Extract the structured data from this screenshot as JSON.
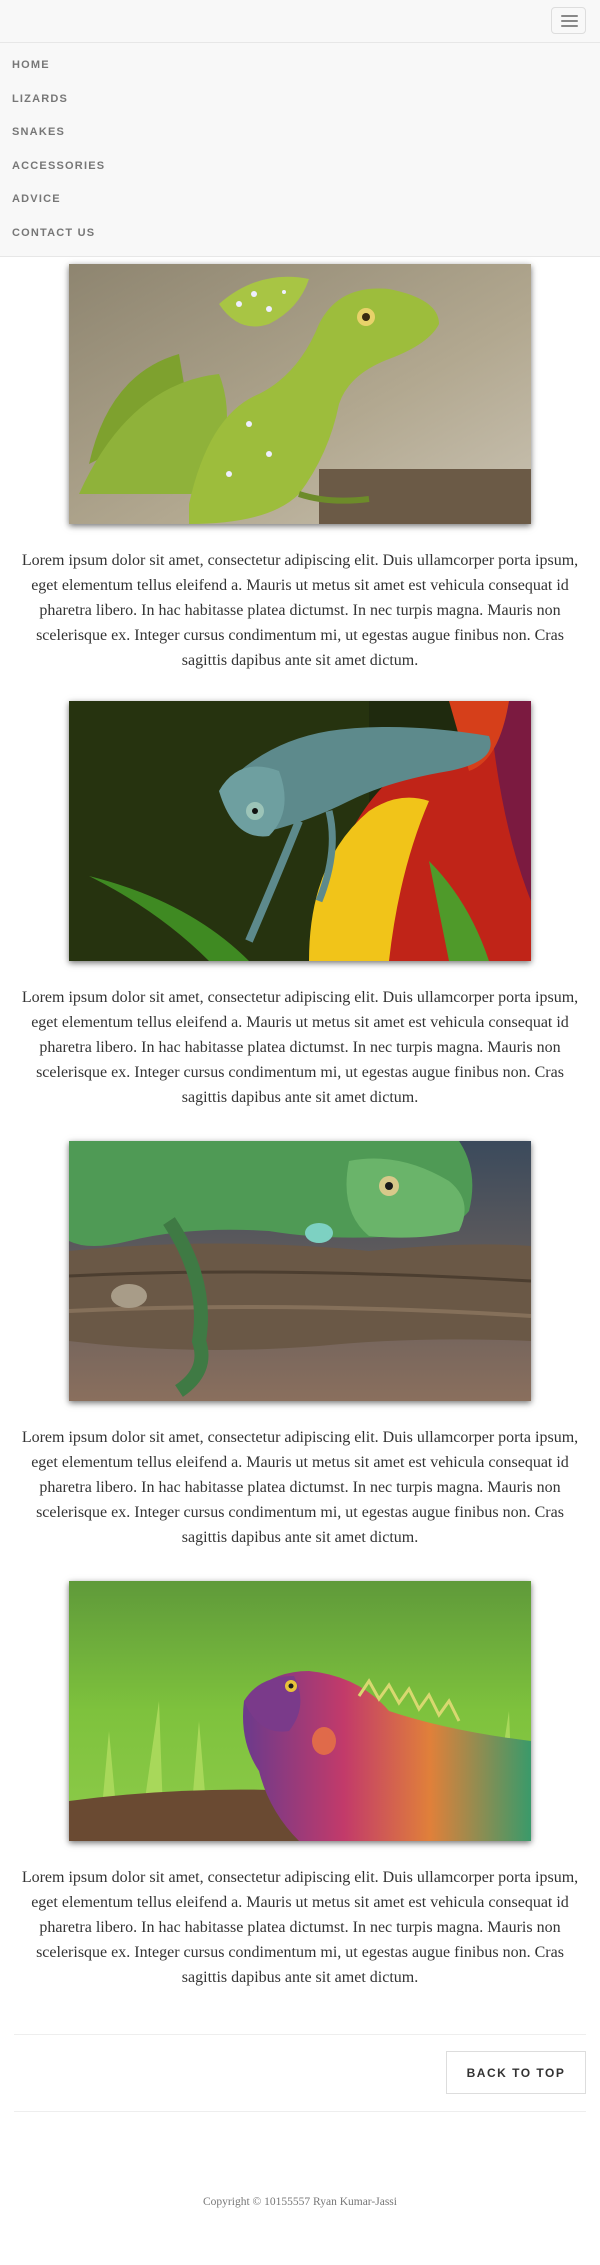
{
  "nav": {
    "toggle_icon": "hamburger-icon",
    "items": [
      {
        "label": "HOME"
      },
      {
        "label": "LIZARDS"
      },
      {
        "label": "SNAKES"
      },
      {
        "label": "ACCESSORIES"
      },
      {
        "label": "ADVICE"
      },
      {
        "label": "CONTACT US"
      }
    ]
  },
  "posts": [
    {
      "image": "green-basilisk-lizard",
      "text": "Lorem ipsum dolor sit amet, consectetur adipiscing elit. Duis ullamcorper porta ipsum, eget elementum tellus eleifend a. Mauris ut metus sit amet est vehicula consequat id pharetra libero. In hac habitasse platea dictumst. In nec turpis magna. Mauris non scelerisque ex. Integer cursus condimentum mi, ut egestas augue finibus non. Cras sagittis dapibus ante sit amet dictum."
    },
    {
      "image": "chameleon-on-flower",
      "text": "Lorem ipsum dolor sit amet, consectetur adipiscing elit. Duis ullamcorper porta ipsum, eget elementum tellus eleifend a. Mauris ut metus sit amet est vehicula consequat id pharetra libero. In hac habitasse platea dictumst. In nec turpis magna. Mauris non scelerisque ex. Integer cursus condimentum mi, ut egestas augue finibus non. Cras sagittis dapibus ante sit amet dictum."
    },
    {
      "image": "green-iguana-on-branch",
      "text": "Lorem ipsum dolor sit amet, consectetur adipiscing elit. Duis ullamcorper porta ipsum, eget elementum tellus eleifend a. Mauris ut metus sit amet est vehicula consequat id pharetra libero. In hac habitasse platea dictumst. In nec turpis magna. Mauris non scelerisque ex. Integer cursus condimentum mi, ut egestas augue finibus non. Cras sagittis dapibus ante sit amet dictum."
    },
    {
      "image": "rainbow-iguana-in-grass",
      "text": "Lorem ipsum dolor sit amet, consectetur adipiscing elit. Duis ullamcorper porta ipsum, eget elementum tellus eleifend a. Mauris ut metus sit amet est vehicula consequat id pharetra libero. In hac habitasse platea dictumst. In nec turpis magna. Mauris non scelerisque ex. Integer cursus condimentum mi, ut egestas augue finibus non. Cras sagittis dapibus ante sit amet dictum."
    }
  ],
  "footer": {
    "back_to_top": "BACK TO TOP",
    "copyright": "Copyright © 10155557 Ryan Kumar-Jassi"
  }
}
